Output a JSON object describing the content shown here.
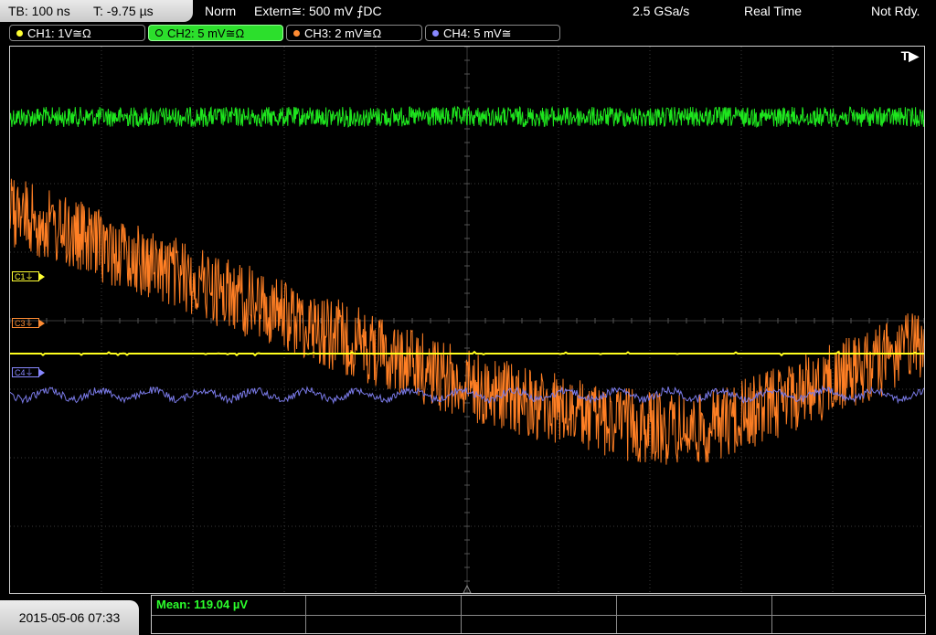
{
  "timebase": {
    "tb": "TB: 100 ns",
    "t": "T: -9.75 µs"
  },
  "status": {
    "mode": "Norm",
    "trigger": "Extern≅: 500 mV ⨍DC",
    "sample_rate": "2.5 GSa/s",
    "acq": "Real Time",
    "state": "Not Rdy."
  },
  "channels": [
    {
      "label": "CH1: 1V≅Ω",
      "color": "#ffff33",
      "active": false
    },
    {
      "label": "CH2: 5 mV≅Ω",
      "color": "#33e033",
      "active": true
    },
    {
      "label": "CH3: 2 mV≅Ω",
      "color": "#ff8c33",
      "active": false
    },
    {
      "label": "CH4: 5 mV≅",
      "color": "#8888ff",
      "active": false
    }
  ],
  "trigger_marker": "T▶",
  "ref_markers": [
    {
      "label": "C1⏚",
      "color": "#ffff33"
    },
    {
      "label": "C3⏚",
      "color": "#ff8c33"
    },
    {
      "label": "C4⏚",
      "color": "#8888ff"
    }
  ],
  "datetime": "2015-05-06 07:33",
  "measurement": {
    "text": "Mean: 119.04 µV"
  },
  "trace_colors": {
    "ch1": "#ffff1e",
    "ch2": "#1ee61e",
    "ch3": "#ff7f24",
    "ch4": "#7a7ae8"
  }
}
